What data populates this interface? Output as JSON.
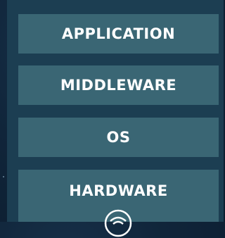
{
  "stack": {
    "layers": [
      {
        "label": "APPLICATION"
      },
      {
        "label": "MIDDLEWARE"
      },
      {
        "label": "OS"
      },
      {
        "label": "HARDWARE"
      }
    ]
  },
  "colors": {
    "background": "#0c1d2f",
    "panel": "#1c3e52",
    "layer_box": "#3a6674",
    "text": "#ffffff"
  },
  "icons": {
    "bottom_logo": "circle-logo-icon"
  }
}
